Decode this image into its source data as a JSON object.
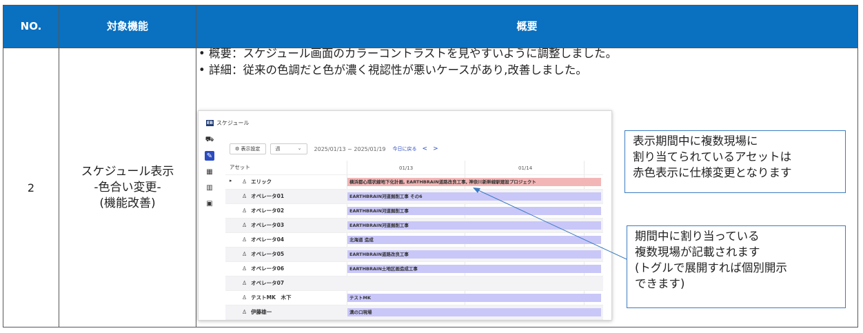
{
  "header": {
    "no": "NO.",
    "function": "対象機能",
    "summary": "概要"
  },
  "row": {
    "no": "2",
    "function_lines": [
      "スケジュール表示",
      "-色合い変更-",
      "(機能改善)"
    ],
    "bullets": [
      "概要：スケジュール画面のカラーコントラストを見やすいように調整しました。",
      "詳細：従来の色調だと色が濃く視認性が悪いケースがあり,改善しました。"
    ]
  },
  "screenshot": {
    "logo": "EB",
    "title": "スケジュール",
    "display_settings": "表示設定",
    "period_select": "週",
    "date_range": "2025/01/13 ~ 2025/01/19",
    "today_link": "今日に戻る",
    "prev": "<",
    "next": ">",
    "asset_header": "アセット",
    "col1": "01/13",
    "col2": "01/14",
    "rows": [
      {
        "name": "エリック",
        "bar": "横浜都心環状線地下化計画, EARTHBRAIN道路改良工事, 神奈川新幹線駅建設プロジェクト"
      },
      {
        "name": "オペレータ01",
        "bar": "EARTHBRAIN河道掘削工事 その6"
      },
      {
        "name": "オペレータ02",
        "bar": "EARTHBRAIN河道掘削工事"
      },
      {
        "name": "オペレータ03",
        "bar": "EARTHBRAIN河道掘削工事"
      },
      {
        "name": "オペレータ04",
        "bar": "北海道 造成"
      },
      {
        "name": "オペレータ05",
        "bar": "EARTHBRAIN道路改良工事"
      },
      {
        "name": "オペレータ06",
        "bar": "EARTHBRAIN土地区画造成工事"
      },
      {
        "name": "オペレータ07",
        "bar": ""
      },
      {
        "name": "テストMK　木下",
        "bar": "テストMK"
      },
      {
        "name": "伊藤雄一",
        "bar": "溝の口現場"
      }
    ]
  },
  "callout_red": {
    "lines": [
      "表示期間中に複数現場に",
      "割り当てられているアセットは",
      "赤色表示に仕様変更となります"
    ]
  },
  "callout_multi": {
    "lines": [
      "期間中に割り当っている",
      "複数現場が記載されます",
      "(トグルで展開すれば個別開示",
      "できます)"
    ]
  },
  "colors": {
    "header_bg": "#0a70c0",
    "red_bar": "#f3b6b6",
    "bar": "#c9c7f8",
    "callout_border": "#3a7ac0"
  }
}
